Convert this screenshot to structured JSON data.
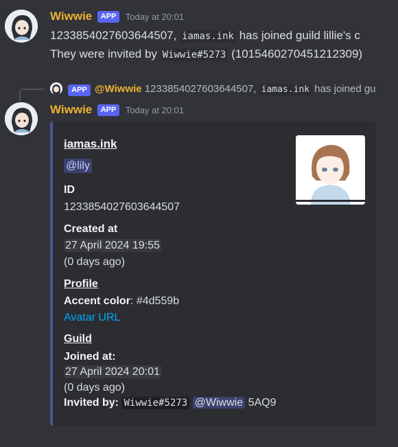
{
  "message1": {
    "username": "Wiwwie",
    "badge": "APP",
    "timestamp": "Today at 20:01",
    "line1_id": "1233854027603644507,",
    "line1_code": "iamas.ink",
    "line1_rest": "has joined guild lillie's c",
    "line2_prefix": "They were invited by",
    "line2_code": "Wiwwie#5273",
    "line2_rest": "(1015460270451212309)"
  },
  "reply": {
    "badge": "APP",
    "mention": "@Wiwwie",
    "text_id": "1233854027603644507,",
    "text_code": "iamas.ink",
    "text_rest": "has joined gu"
  },
  "message2": {
    "username": "Wiwwie",
    "badge": "APP",
    "timestamp": "Today at 20:01"
  },
  "embed": {
    "title": "iamas.ink",
    "mention": "@lily",
    "id_label": "ID",
    "id_value": "1233854027603644507",
    "created_label": "Created at",
    "created_date": "27 April 2024 19:55",
    "created_ago": "(0 days ago)",
    "profile_heading": "Profile",
    "accent_label": "Accent color",
    "accent_value": ": #4d559b",
    "avatar_url": "Avatar URL",
    "guild_heading": "Guild",
    "joined_label": "Joined at:",
    "joined_date": "27 April 2024 20:01",
    "joined_ago": "(0 days ago)",
    "invited_label": "Invited by:",
    "invited_code": "Wiwwie#5273",
    "invited_mention": "@Wiwwie",
    "invited_code2": "5AQ9"
  },
  "colors": {
    "background": "#313338",
    "embed_background": "#2b2d31",
    "embed_accent": "#4d559b",
    "username": "#f0b232",
    "app_badge": "#5865f2",
    "link": "#00a8fc"
  }
}
